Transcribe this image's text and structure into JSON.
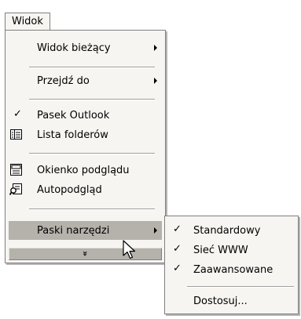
{
  "menubar": {
    "label": "Widok"
  },
  "menu": {
    "current_view": "Widok bieżący",
    "go_to": "Przejdź do",
    "outlook_bar": "Pasek Outlook",
    "folder_list": "Lista folderów",
    "preview_pane": "Okienko podglądu",
    "autopreview": "Autopodgląd",
    "toolbars": "Paski narzędzi",
    "expand_chevron": "»"
  },
  "submenu": {
    "standard": "Standardowy",
    "web": "Sieć WWW",
    "advanced": "Zaawansowane",
    "customize": "Dostosuj..."
  },
  "marks": {
    "check": "✓"
  },
  "colors": {
    "menu_bg": "#f7f5f2",
    "highlight": "#b5b2ac",
    "border": "#808080"
  }
}
